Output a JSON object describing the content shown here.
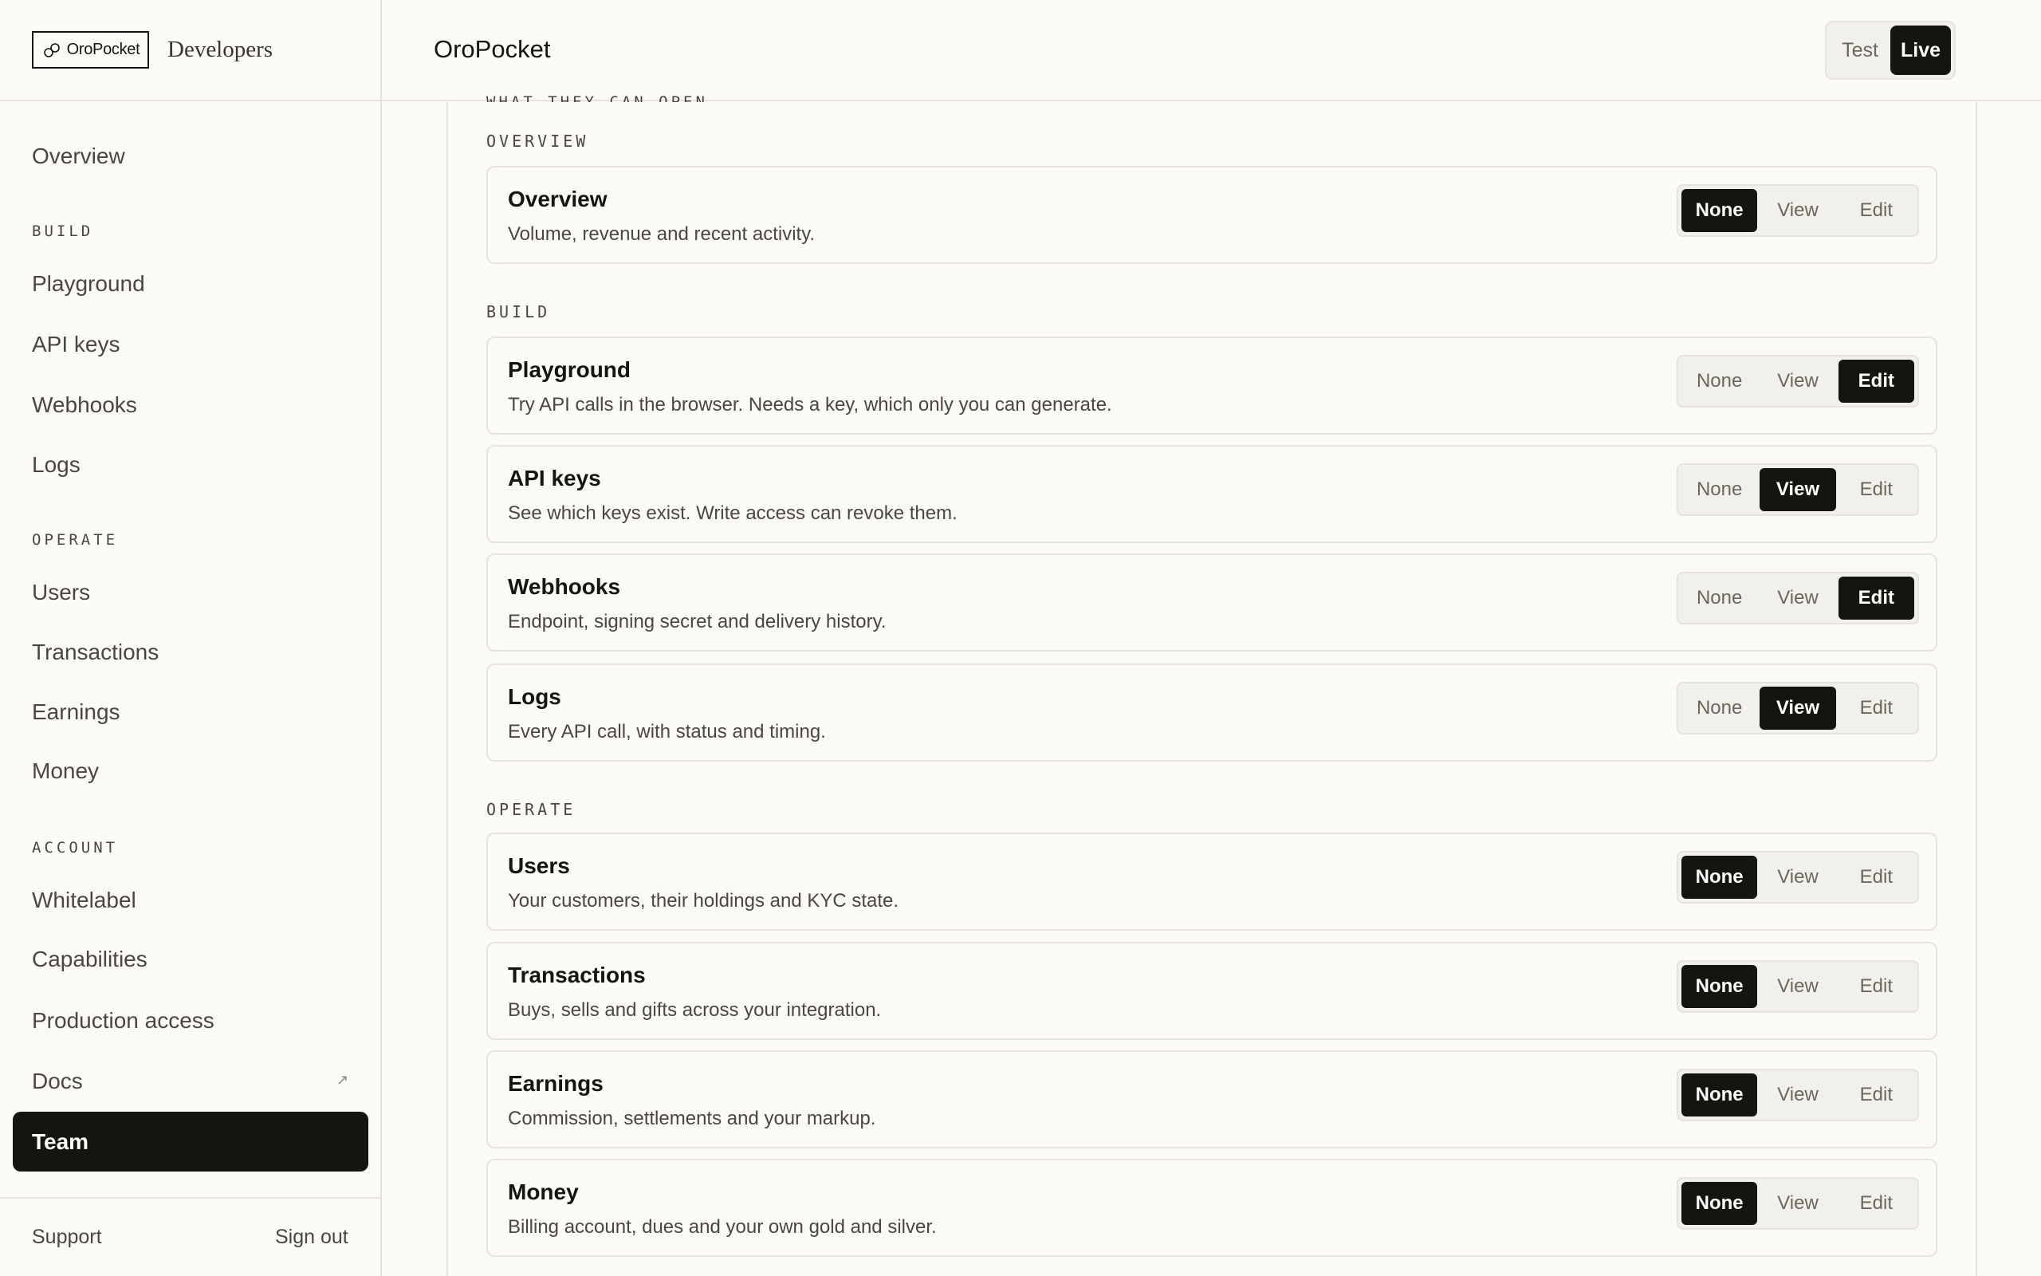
{
  "brand": {
    "logo_text": "OroPocket",
    "sub": "Developers"
  },
  "header": {
    "title": "OroPocket",
    "env": {
      "test": "Test",
      "live": "Live",
      "selected": "Live"
    }
  },
  "nav": {
    "overview": "Overview",
    "sections": {
      "build": "BUILD",
      "operate": "OPERATE",
      "account": "ACCOUNT"
    },
    "build": [
      "Playground",
      "API keys",
      "Webhooks",
      "Logs"
    ],
    "operate": [
      "Users",
      "Transactions",
      "Earnings",
      "Money"
    ],
    "account": [
      "Whitelabel",
      "Capabilities",
      "Production access",
      "Docs"
    ],
    "active": "Team",
    "docs_external_icon": "external-arrow-icon"
  },
  "footer": {
    "support": "Support",
    "sign_out": "Sign out"
  },
  "permissions": {
    "heading_partial": "WHAT THEY CAN OPEN",
    "options": [
      "None",
      "View",
      "Edit"
    ],
    "groups": [
      {
        "label": "OVERVIEW",
        "items": [
          {
            "title": "Overview",
            "desc": "Volume, revenue and recent activity.",
            "level": "None"
          }
        ]
      },
      {
        "label": "BUILD",
        "items": [
          {
            "title": "Playground",
            "desc": "Try API calls in the browser. Needs a key, which only you can generate.",
            "level": "Edit"
          },
          {
            "title": "API keys",
            "desc": "See which keys exist. Write access can revoke them.",
            "level": "View"
          },
          {
            "title": "Webhooks",
            "desc": "Endpoint, signing secret and delivery history.",
            "level": "Edit"
          },
          {
            "title": "Logs",
            "desc": "Every API call, with status and timing.",
            "level": "View"
          }
        ]
      },
      {
        "label": "OPERATE",
        "items": [
          {
            "title": "Users",
            "desc": "Your customers, their holdings and KYC state.",
            "level": "None"
          },
          {
            "title": "Transactions",
            "desc": "Buys, sells and gifts across your integration.",
            "level": "None"
          },
          {
            "title": "Earnings",
            "desc": "Commission, settlements and your markup.",
            "level": "None"
          },
          {
            "title": "Money",
            "desc": "Billing account, dues and your own gold and silver.",
            "level": "None"
          }
        ]
      }
    ]
  },
  "colors": {
    "ink": "#16140f",
    "border": "#e7e4db",
    "background": "#fbfaf6",
    "segment_bg": "#f2f0ea"
  }
}
